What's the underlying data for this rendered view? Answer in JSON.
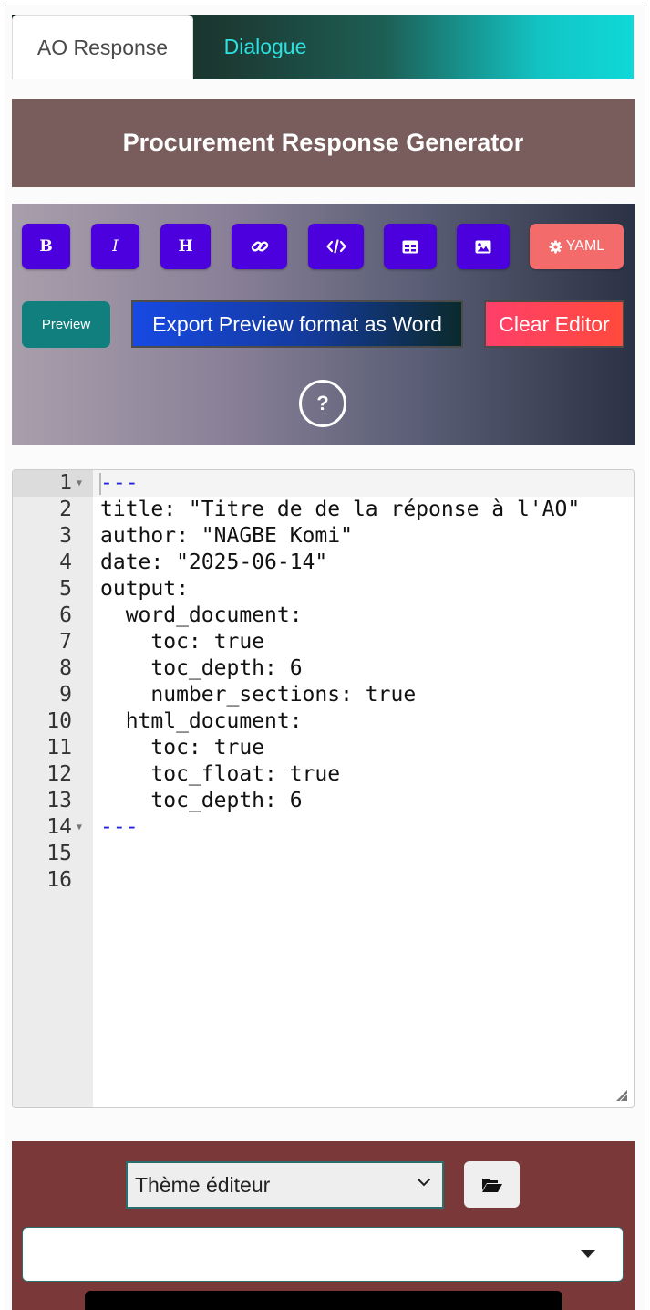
{
  "tabs": {
    "active": "AO Response",
    "inactive": "Dialogue"
  },
  "header": {
    "title": "Procurement Response Generator"
  },
  "toolbar": {
    "bold": "B",
    "italic": "I",
    "heading": "H",
    "yaml": "YAML",
    "preview": "Preview",
    "export": "Export Preview format as Word",
    "clear": "Clear Editor",
    "help": "?"
  },
  "editor": {
    "lines": [
      {
        "n": "1",
        "text": "---",
        "fold": true,
        "dash": true
      },
      {
        "n": "2",
        "text": "title: \"Titre de de la réponse à l'AO\""
      },
      {
        "n": "3",
        "text": "author: \"NAGBE Komi\""
      },
      {
        "n": "4",
        "text": "date: \"2025-06-14\""
      },
      {
        "n": "5",
        "text": "output:"
      },
      {
        "n": "6",
        "text": "  word_document:"
      },
      {
        "n": "7",
        "text": "    toc: true"
      },
      {
        "n": "8",
        "text": "    toc_depth: 6"
      },
      {
        "n": "9",
        "text": "    number_sections: true"
      },
      {
        "n": "10",
        "text": "  html_document:"
      },
      {
        "n": "11",
        "text": "    toc: true"
      },
      {
        "n": "12",
        "text": "    toc_float: true"
      },
      {
        "n": "13",
        "text": "    toc_depth: 6"
      },
      {
        "n": "14",
        "text": "---",
        "fold": true,
        "dash": true
      },
      {
        "n": "15",
        "text": ""
      },
      {
        "n": "16",
        "text": ""
      }
    ]
  },
  "bottom": {
    "theme_select": "Thème éditeur",
    "combo_value": ""
  },
  "colors": {
    "tool_button": "#4b00dd",
    "yaml_button": "#f36b6b",
    "header_bg": "#785d5c",
    "bottom_bg": "#7a3838"
  }
}
